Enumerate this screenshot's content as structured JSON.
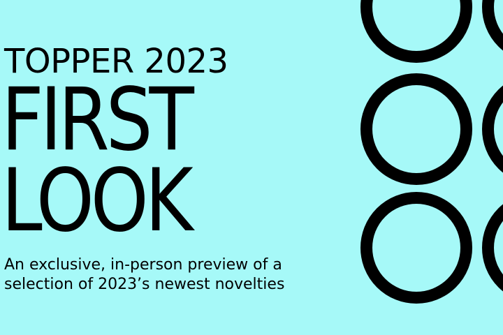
{
  "banner": {
    "eyebrow": "TOPPER 2023",
    "headline": [
      "FIRST",
      "LOOK"
    ],
    "subtitle": [
      "An exclusive, in-person preview of a",
      "selection of 2023’s newest novelties"
    ],
    "background_color": "#a6f9f8",
    "text_color": "#000000"
  }
}
